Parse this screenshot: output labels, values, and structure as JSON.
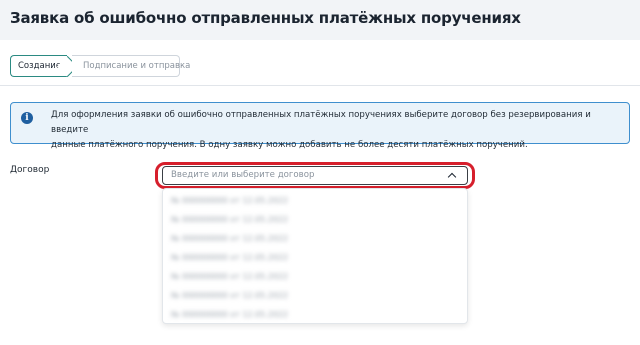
{
  "page": {
    "title": "Заявка об ошибочно отправленных платёжных поручениях"
  },
  "steps": [
    {
      "label": "Создание",
      "active": true
    },
    {
      "label": "Подписание и отправка",
      "active": false
    }
  ],
  "info": {
    "icon": "info-icon",
    "text_line1": "Для оформления заявки об ошибочно отправленных платёжных поручениях выберите договор без резервирования и введите",
    "text_line2": "данные платёжного поручения. В одну заявку можно добавить не более десяти платёжных поручений."
  },
  "form": {
    "contract_label": "Договор",
    "contract_placeholder": "Введите или выберите договор",
    "contract_options": [
      "№ 000000000 от 12.05.2022",
      "№ 000000000 от 12.05.2022",
      "№ 000000000 от 12.05.2022",
      "№ 000000000 от 12.05.2022",
      "№ 000000000 от 12.05.2022",
      "№ 000000000 от 12.05.2022",
      "№ 000000000 от 12.05.2022"
    ]
  },
  "colors": {
    "accent": "#2b8a82",
    "info_border": "#3f8fce",
    "info_bg": "#eaf3fa",
    "highlight": "#d61f2c"
  }
}
